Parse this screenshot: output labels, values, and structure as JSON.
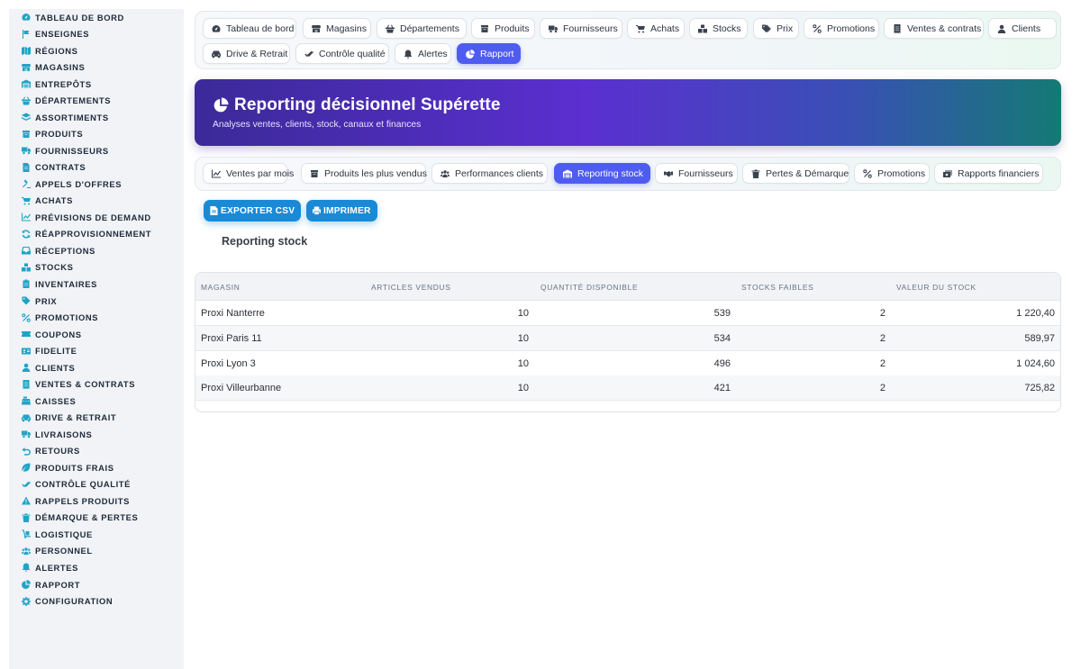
{
  "sidebar": {
    "items": [
      {
        "label": "Tableau de bord",
        "icon": "gauge-icon"
      },
      {
        "label": "Enseignes",
        "icon": "flag-icon"
      },
      {
        "label": "Régions",
        "icon": "map-icon"
      },
      {
        "label": "Magasins",
        "icon": "store-icon"
      },
      {
        "label": "Entrepôts",
        "icon": "warehouse-icon"
      },
      {
        "label": "Départements",
        "icon": "basket-icon"
      },
      {
        "label": "Assortiments",
        "icon": "layers-icon"
      },
      {
        "label": "Produits",
        "icon": "box-icon"
      },
      {
        "label": "Fournisseurs",
        "icon": "truck-icon"
      },
      {
        "label": "Contrats",
        "icon": "file-icon"
      },
      {
        "label": "Appels d'offres",
        "icon": "gavel-icon"
      },
      {
        "label": "Achats",
        "icon": "cart-icon"
      },
      {
        "label": "Prévisions de demand",
        "icon": "chart-line-icon"
      },
      {
        "label": "Réapprovisionnement",
        "icon": "refresh-icon"
      },
      {
        "label": "Réceptions",
        "icon": "inbox-icon"
      },
      {
        "label": "Stocks",
        "icon": "boxes-icon"
      },
      {
        "label": "Inventaires",
        "icon": "clipboard-icon"
      },
      {
        "label": "Prix",
        "icon": "tag-icon"
      },
      {
        "label": "Promotions",
        "icon": "percent-icon"
      },
      {
        "label": "Coupons",
        "icon": "ticket-icon"
      },
      {
        "label": "Fidelite",
        "icon": "id-card-icon"
      },
      {
        "label": "Clients",
        "icon": "user-icon"
      },
      {
        "label": "Ventes & contrats",
        "icon": "receipt-icon"
      },
      {
        "label": "Caisses",
        "icon": "cash-register-icon"
      },
      {
        "label": "Drive & retrait",
        "icon": "car-icon"
      },
      {
        "label": "Livraisons",
        "icon": "delivery-truck-icon"
      },
      {
        "label": "Retours",
        "icon": "undo-icon"
      },
      {
        "label": "Produits frais",
        "icon": "leaf-icon"
      },
      {
        "label": "Contrôle qualité",
        "icon": "check-double-icon"
      },
      {
        "label": "Rappels produits",
        "icon": "warning-icon"
      },
      {
        "label": "Démarque & pertes",
        "icon": "trash-icon"
      },
      {
        "label": "Logistique",
        "icon": "dolly-icon"
      },
      {
        "label": "Personnel",
        "icon": "users-icon"
      },
      {
        "label": "Alertes",
        "icon": "bell-icon"
      },
      {
        "label": "Rapport",
        "icon": "pie-chart-icon"
      },
      {
        "label": "Configuration",
        "icon": "gear-icon"
      }
    ]
  },
  "topnav": {
    "items": [
      {
        "label": "Tableau de bord",
        "icon": "gauge-icon",
        "active": false
      },
      {
        "label": "Magasins",
        "icon": "store-icon",
        "active": false
      },
      {
        "label": "Départements",
        "icon": "basket-icon",
        "active": false
      },
      {
        "label": "Produits",
        "icon": "box-icon",
        "active": false
      },
      {
        "label": "Fournisseurs",
        "icon": "truck-icon",
        "active": false
      },
      {
        "label": "Achats",
        "icon": "cart-icon",
        "active": false
      },
      {
        "label": "Stocks",
        "icon": "boxes-icon",
        "active": false
      },
      {
        "label": "Prix",
        "icon": "tags-icon",
        "active": false
      },
      {
        "label": "Promotions",
        "icon": "percent-icon",
        "active": false
      },
      {
        "label": "Ventes & contrats",
        "icon": "receipt-icon",
        "active": false
      },
      {
        "label": "Clients",
        "icon": "user-icon",
        "active": false
      },
      {
        "label": "Drive & Retrait",
        "icon": "car-icon",
        "active": false
      },
      {
        "label": "Contrôle qualité",
        "icon": "check-double-icon",
        "active": false
      },
      {
        "label": "Alertes",
        "icon": "bell-icon",
        "active": false
      },
      {
        "label": "Rapport",
        "icon": "pie-chart-icon",
        "active": true
      }
    ]
  },
  "hero": {
    "title": "Reporting décisionnel Supérette",
    "subtitle": "Analyses ventes, clients, stock, canaux et finances",
    "icon": "pie-chart-icon"
  },
  "subtabs": {
    "items": [
      {
        "label": "Ventes par mois",
        "icon": "chart-line-icon",
        "active": false
      },
      {
        "label": "Produits les plus vendus",
        "icon": "box-icon",
        "active": false
      },
      {
        "label": "Performances clients",
        "icon": "users-icon",
        "active": false
      },
      {
        "label": "Reporting stock",
        "icon": "warehouse-icon",
        "active": true
      },
      {
        "label": "Fournisseurs",
        "icon": "handshake-icon",
        "active": false
      },
      {
        "label": "Pertes & Démarque",
        "icon": "trash-icon",
        "active": false
      },
      {
        "label": "Promotions",
        "icon": "percent-icon",
        "active": false
      },
      {
        "label": "Rapports financiers",
        "icon": "money-bill-icon",
        "active": false
      }
    ]
  },
  "actions": {
    "export_label": "EXPORTER CSV",
    "print_label": "IMPRIMER"
  },
  "section": {
    "title": "Reporting stock"
  },
  "table": {
    "columns": [
      "Magasin",
      "Articles vendus",
      "Quantité disponible",
      "Stocks faibles",
      "Valeur du stock"
    ],
    "rows": [
      [
        "Proxi Nanterre",
        "10",
        "539",
        "2",
        "1 220,40"
      ],
      [
        "Proxi Paris 11",
        "10",
        "534",
        "2",
        "589,97"
      ],
      [
        "Proxi Lyon 3",
        "10",
        "496",
        "2",
        "1 024,60"
      ],
      [
        "Proxi Villeurbanne",
        "10",
        "421",
        "2",
        "725,82"
      ]
    ]
  },
  "colors": {
    "accent": "#4f5cf0",
    "sidebar_icon": "#20a4c6",
    "button": "#1a8ad6"
  }
}
